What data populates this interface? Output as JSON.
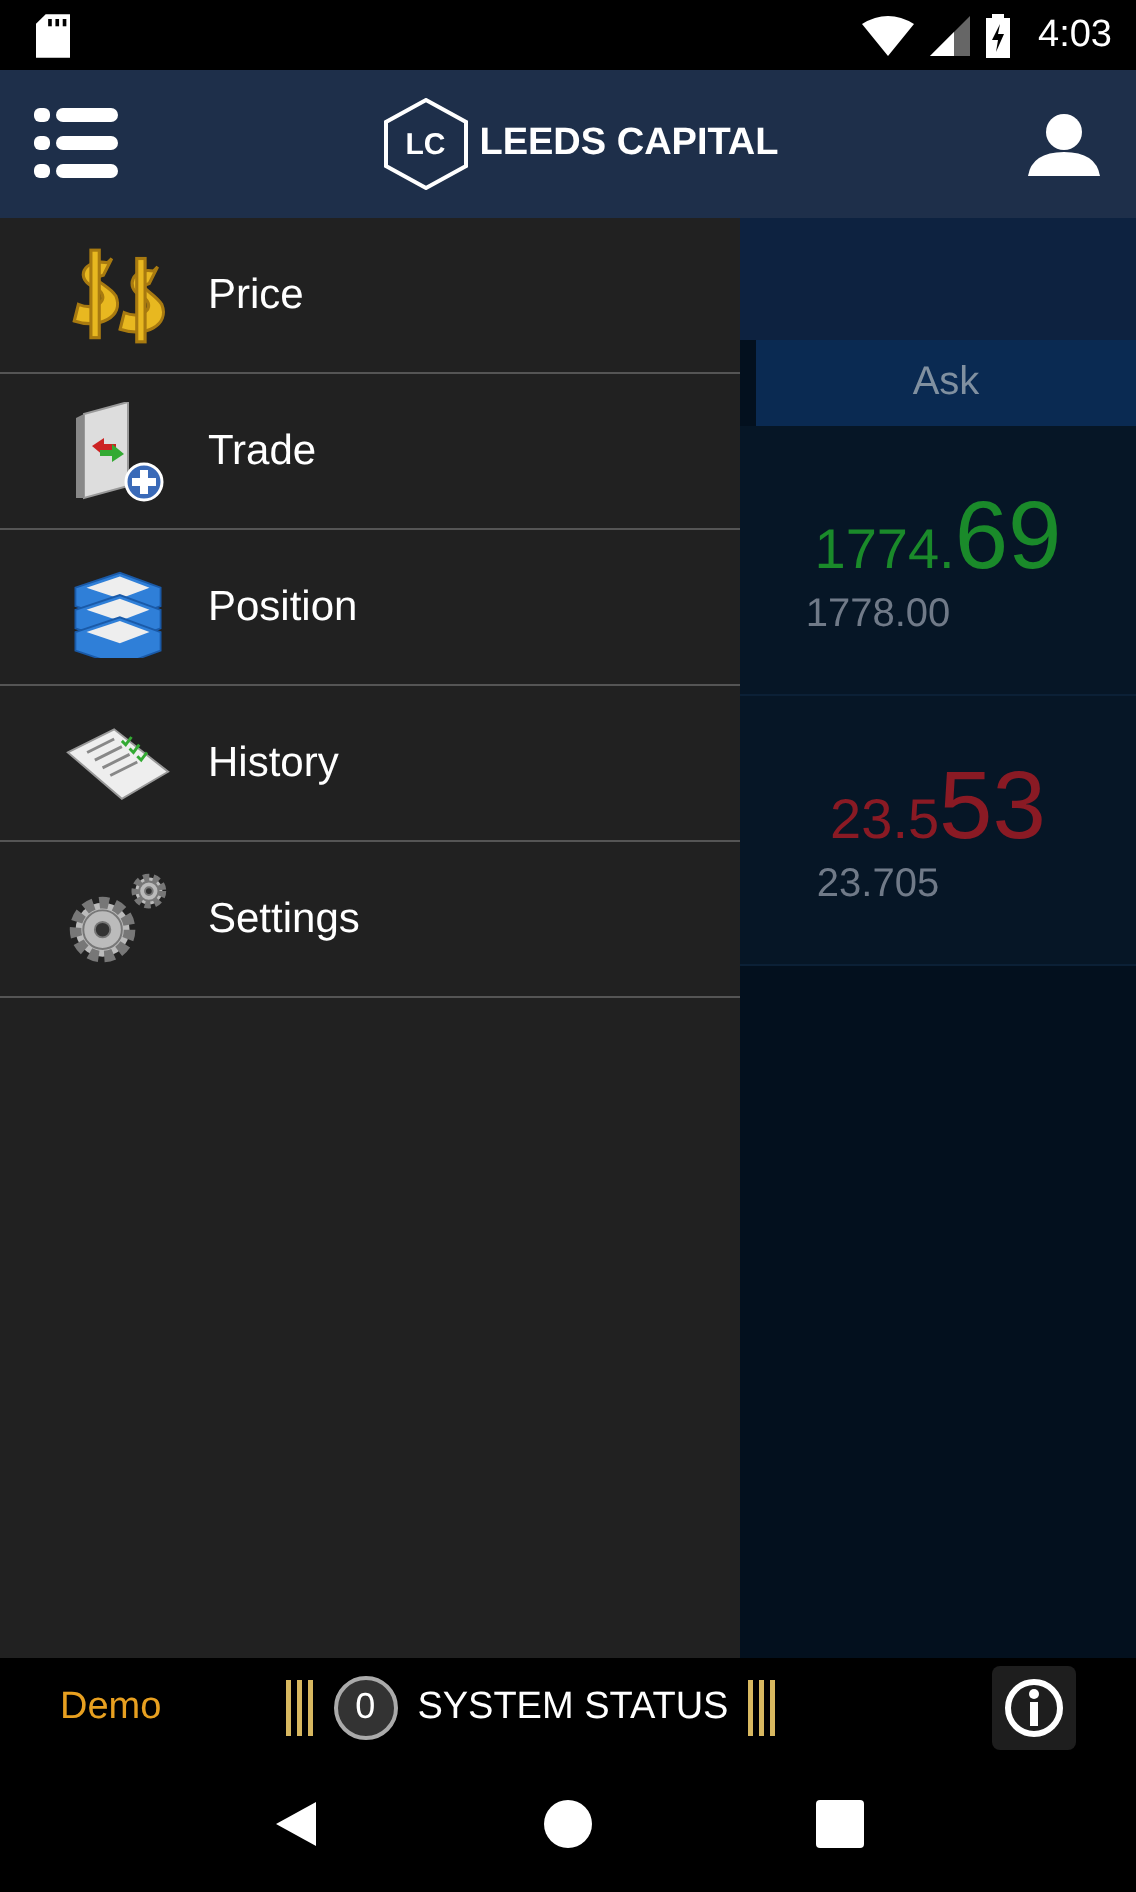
{
  "status_bar": {
    "time": "4:03"
  },
  "header": {
    "logo_mark": "LC",
    "brand": "LEEDS CAPITAL"
  },
  "menu": [
    {
      "label": "Price",
      "kind": "price"
    },
    {
      "label": "Trade",
      "kind": "trade"
    },
    {
      "label": "Position",
      "kind": "position"
    },
    {
      "label": "History",
      "kind": "history"
    },
    {
      "label": "Settings",
      "kind": "settings"
    }
  ],
  "quotes": {
    "column": "Ask",
    "rows": [
      {
        "main": "1774.",
        "pips": "69",
        "sub": "1778.00",
        "color": "#1a8a2a"
      },
      {
        "main": "23.5",
        "pips": "53",
        "sub": "23.705",
        "color": "#8a1a24"
      }
    ]
  },
  "footer": {
    "mode": "Demo",
    "alert_count": "0",
    "status": "SYSTEM STATUS"
  }
}
